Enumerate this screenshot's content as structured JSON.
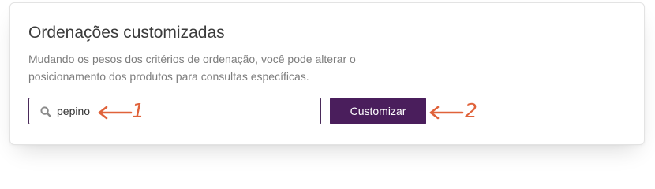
{
  "panel": {
    "title": "Ordenações customizadas",
    "description": "Mudando os pesos dos critérios de ordenação, você pode alterar o posicionamento dos produtos para consultas específicas."
  },
  "search": {
    "value": "pepino",
    "icon": "search-icon"
  },
  "submit_button": {
    "label": "Customizar"
  },
  "annotations": [
    {
      "label": "1",
      "target": "search-input"
    },
    {
      "label": "2",
      "target": "submit-button"
    }
  ],
  "colors": {
    "accent": "#4a1e5c",
    "annotation": "#e0623a",
    "title": "#3b3b3b",
    "description": "#7d7d7d"
  }
}
